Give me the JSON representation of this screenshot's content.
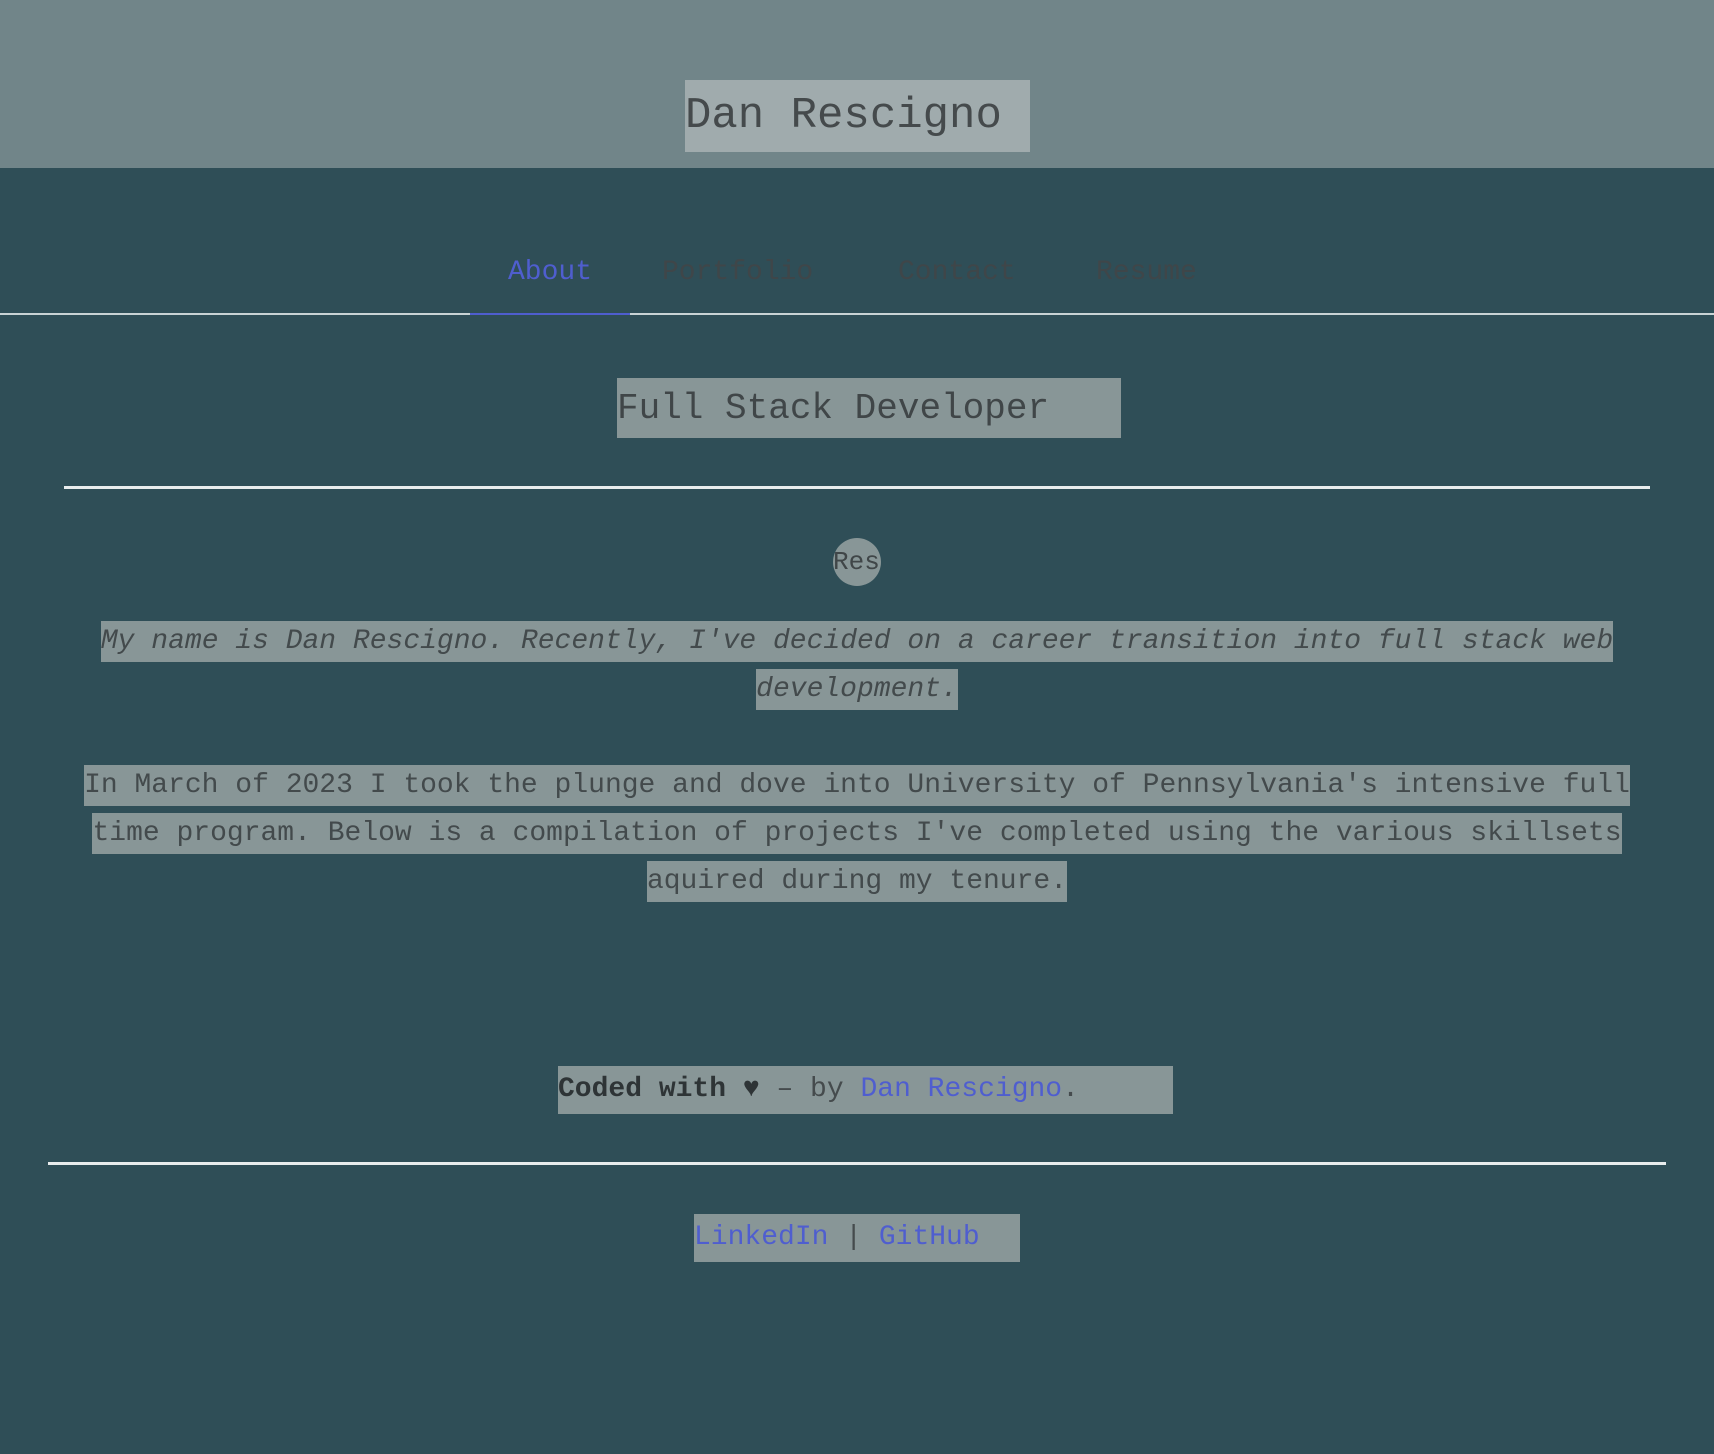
{
  "header": {
    "title": "Dan Rescigno"
  },
  "nav": {
    "items": [
      {
        "label": "About",
        "active": true
      },
      {
        "label": "Portfolio",
        "active": false
      },
      {
        "label": "Contact",
        "active": false
      },
      {
        "label": "Resume",
        "active": false
      }
    ]
  },
  "main": {
    "subtitle": "Full Stack Developer",
    "avatar_alt": "Res",
    "intro": "My name is Dan Rescigno. Recently, I've decided on a career transition into full stack web development.",
    "bio": "In March of 2023 I took the plunge and dove into University of Pennsylvania's intensive full time program. Below is a compilation of projects I've completed using the various skillsets aquired during my tenure."
  },
  "footer": {
    "coded_with": "Coded with ♥",
    "by": " – by ",
    "author_link": "Dan Rescigno",
    "period": ".",
    "links": {
      "linkedin": "LinkedIn",
      "separator": " | ",
      "github": "GitHub"
    }
  },
  "colors": {
    "background": "#2f4e57",
    "header_bg": "#718589",
    "highlight_bg": "#889697",
    "link": "#4f5ecf",
    "rule": "#e8eced"
  }
}
